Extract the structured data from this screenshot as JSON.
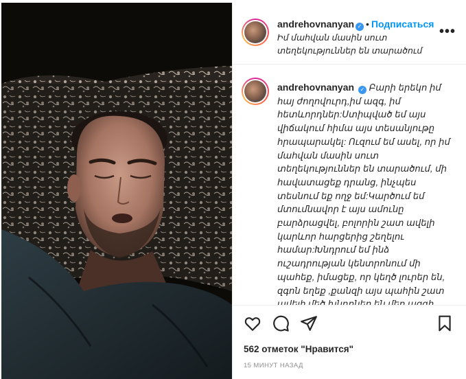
{
  "post": {
    "username": "andrehovnanyan",
    "verified_mark": "✓",
    "follow_label": "Подписаться",
    "separator": "•",
    "location": "Իմ մահվան մասին սուտ տեղեկություններ են տարածում",
    "caption": "Բարի երեկո իմ հայ ժողովուրդ,իմ ազգ, իմ հետևորդներ:Ստիպված եմ այս վիճակում հիմա այս տեսանյութը հրապարակել: Ուզում եմ ասել, որ իմ մահվան մասին սուտ տեղեկություններ են տարածում, մի հավատացեք դրանց, ինչպես տեսնում եք ողջ եմ:Կարծում եմ մտումնավոր է այս ամունը բարձրացվել, բոլորին շատ ավելի կարևոր հարցերից շեղելու համար:Խնդրում եմ ինձ ուշադրության կենտրոնում մի պահեք, իմացեք, որ կեղծ լուրեր են, զգոն եղեք ,քանզի այս պահին շատ ավելի մեծ խնդրներ են մեր ազգի առջև, մեր բոլորի առջև ծառացած,",
    "more_icon": "more-horizontal-icon",
    "likes": "562 отметок \"Нравится\"",
    "time_ago": "15 минут назад"
  },
  "actions": {
    "like_icon": "heart-icon",
    "comment_icon": "comment-icon",
    "share_icon": "paper-plane-icon",
    "save_icon": "bookmark-icon"
  },
  "colors": {
    "accent": "#0095f6",
    "verified": "#3897f0",
    "text": "#262626",
    "muted": "#8e8e8e",
    "divider": "#efefef"
  }
}
